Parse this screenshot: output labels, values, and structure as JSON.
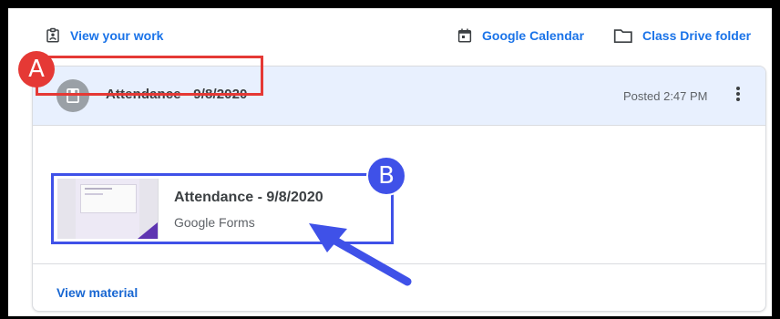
{
  "topbar": {
    "view_your_work": "View your work",
    "google_calendar": "Google Calendar",
    "class_drive_folder": "Class Drive folder"
  },
  "post": {
    "title": "Attendance - 9/8/2020",
    "posted": "Posted 2:47 PM",
    "attachment": {
      "title": "Attendance - 9/8/2020",
      "type": "Google Forms"
    },
    "view_material": "View material"
  },
  "callouts": {
    "a": "A",
    "b": "B"
  },
  "colors": {
    "link": "#1a73e8",
    "header_bg": "#e8f0fe",
    "callout_a": "#e53935",
    "callout_b": "#3f51e8",
    "forms_purple": "#5e35b1"
  },
  "icons": {
    "view_work": "assignment-ind-icon",
    "calendar": "calendar-icon",
    "folder": "folder-icon",
    "post": "bookmark-icon",
    "more": "more-vertical-icon"
  }
}
